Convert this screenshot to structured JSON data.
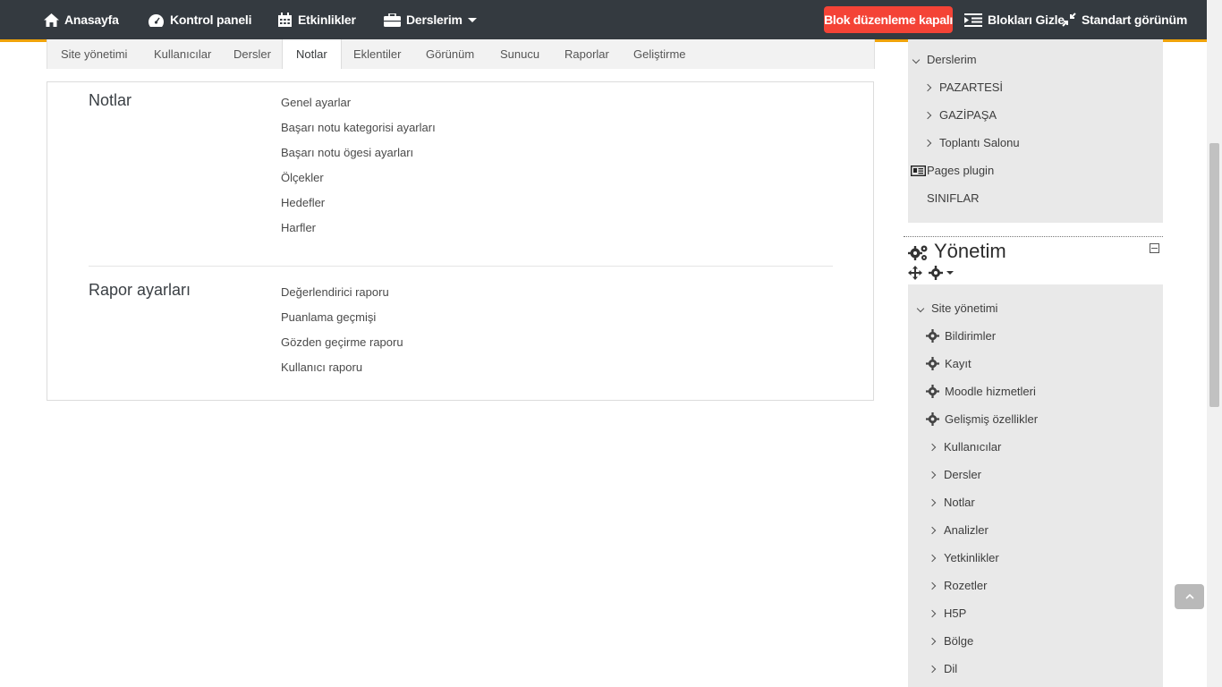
{
  "navbar": {
    "home": "Anasayfa",
    "dashboard": "Kontrol paneli",
    "events": "Etkinlikler",
    "my_courses": "Derslerim",
    "block_edit": "Blok düzenleme kapalı",
    "hide_blocks": "Blokları Gizle",
    "standard_view": "Standart görünüm"
  },
  "tabs": [
    "Site yönetimi",
    "Kullanıcılar",
    "Dersler",
    "Notlar",
    "Eklentiler",
    "Görünüm",
    "Sunucu",
    "Raporlar",
    "Geliştirme"
  ],
  "active_tab": "Notlar",
  "sections": [
    {
      "title": "Notlar",
      "links": [
        "Genel ayarlar",
        "Başarı notu kategorisi ayarları",
        "Başarı notu ögesi ayarları",
        "Ölçekler",
        "Hedefler",
        "Harfler"
      ]
    },
    {
      "title": "Rapor ayarları",
      "links": [
        "Değerlendirici raporu",
        "Puanlama geçmişi",
        "Gözden geçirme raporu",
        "Kullanıcı raporu"
      ]
    }
  ],
  "nav_block": {
    "my_courses": "Derslerim",
    "courses": [
      "PAZARTESİ",
      "GAZİPAŞA",
      "Toplantı Salonu"
    ],
    "pages_plugin": "Pages plugin",
    "classes": "SINIFLAR"
  },
  "admin_block": {
    "title": "Yönetim",
    "site_admin": "Site yönetimi",
    "settings_items": [
      "Bildirimler",
      "Kayıt",
      "Moodle hizmetleri",
      "Gelişmiş özellikler"
    ],
    "categories": [
      "Kullanıcılar",
      "Dersler",
      "Notlar",
      "Analizler",
      "Yetkinlikler",
      "Rozetler",
      "H5P",
      "Bölge",
      "Dil"
    ]
  },
  "colors": {
    "navbar": "#343a40",
    "accent": "#f0a30a",
    "danger": "#f44336"
  }
}
